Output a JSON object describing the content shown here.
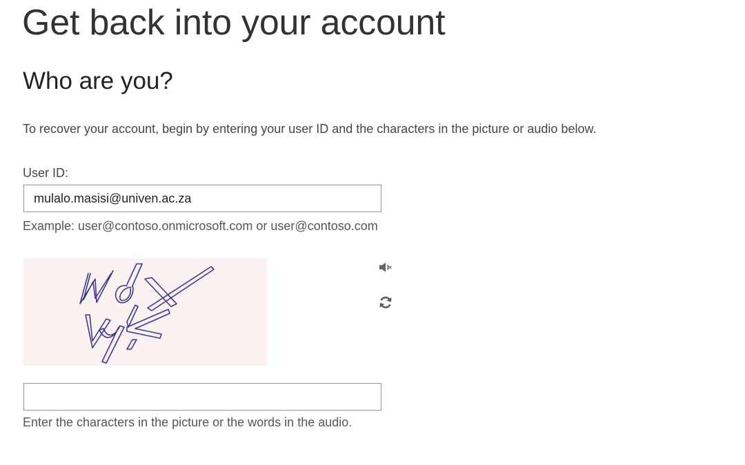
{
  "header": {
    "title": "Get back into your account"
  },
  "form": {
    "section_title": "Who are you?",
    "instructions": "To recover your account, begin by entering your user ID and the characters in the picture or audio below.",
    "user_id_label": "User ID:",
    "user_id_value": "mulalo.masisi@univen.ac.za",
    "user_id_example": "Example: user@contoso.onmicrosoft.com or user@contoso.com",
    "captcha_help": "Enter the characters in the picture or the words in the audio.",
    "captcha_value": ""
  },
  "captcha": {
    "text": "WdX Vyk",
    "ink_color": "#3a3a8c",
    "background_color": "#fbf1f1"
  },
  "icons": {
    "audio": "speaker-icon",
    "refresh": "refresh-icon"
  }
}
